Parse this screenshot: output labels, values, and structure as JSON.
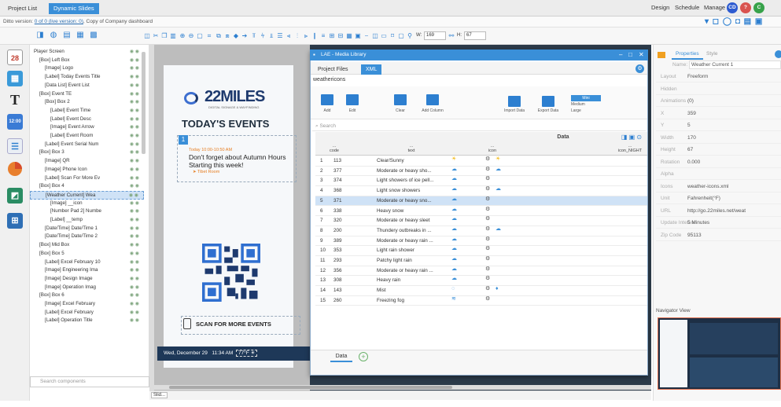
{
  "topbar": {
    "tab_project_list": "Project List",
    "tab_dynamic_slides": "Dynamic Slides",
    "design": "Design",
    "schedule": "Schedule",
    "manage": "Manage",
    "avatars": [
      "CD",
      "",
      "C"
    ]
  },
  "subbar": {
    "version_prefix": "Ditto version: ",
    "version_link": "0 of 0 (live version: 0)",
    "version_suffix": ", Copy of Company dashboard"
  },
  "toolbar": {
    "width_label": "W:",
    "width_value": "169",
    "height_label": "H:",
    "height_value": "67"
  },
  "leftbar": {
    "calendar_day": "28",
    "text_tool": "T"
  },
  "tree": {
    "items": [
      {
        "label": "Player Screen",
        "indent": 0
      },
      {
        "label": "[Box] Left Box",
        "indent": 1
      },
      {
        "label": "[Image] Logo",
        "indent": 2
      },
      {
        "label": "[Label] Today Events Title",
        "indent": 2
      },
      {
        "label": "[Data List] Event List",
        "indent": 2
      },
      {
        "label": "[Box] Event TE",
        "indent": 1
      },
      {
        "label": "[Box] Box 2",
        "indent": 2
      },
      {
        "label": "[Label] Event Time",
        "indent": 3
      },
      {
        "label": "[Label] Event Desc",
        "indent": 3
      },
      {
        "label": "[Image] Event Arrow",
        "indent": 3
      },
      {
        "label": "[Label] Event Room",
        "indent": 3
      },
      {
        "label": "[Label] Event Serial Num",
        "indent": 2
      },
      {
        "label": "[Box] Box 3",
        "indent": 1
      },
      {
        "label": "[Image] QR",
        "indent": 2
      },
      {
        "label": "[Image] Phone Icon",
        "indent": 2
      },
      {
        "label": "[Label] Scan For More Ev",
        "indent": 2
      },
      {
        "label": "[Box] Box 4",
        "indent": 1
      },
      {
        "label": "[Weather Current] Wea",
        "indent": 2
      },
      {
        "label": "[Image] __icon",
        "indent": 3
      },
      {
        "label": "[Number Pad 2] Numbe",
        "indent": 3
      },
      {
        "label": "[Label] __temp",
        "indent": 3
      },
      {
        "label": "[Date/Time] Date/Time 1",
        "indent": 2
      },
      {
        "label": "[Date/Time] Date/Time 2",
        "indent": 2
      },
      {
        "label": "[Box] Mid Box",
        "indent": 1
      },
      {
        "label": "[Box] Box 5",
        "indent": 1
      },
      {
        "label": "[Label] Excel February 10",
        "indent": 2
      },
      {
        "label": "[Image] Engineering Ima",
        "indent": 2
      },
      {
        "label": "[Image] Design Image",
        "indent": 2
      },
      {
        "label": "[Image] Operation Imag",
        "indent": 2
      },
      {
        "label": "[Box] Box 6",
        "indent": 1
      },
      {
        "label": "[Image] Excel February",
        "indent": 2
      },
      {
        "label": "[Label] Excel February",
        "indent": 2
      },
      {
        "label": "[Label] Operation Title",
        "indent": 2
      }
    ],
    "selected_index": 17,
    "search_placeholder": "Search components"
  },
  "canvas": {
    "logo_text": "22MILES",
    "logo_sub": "DIGITAL SIGNAGE & WAYFINDING",
    "title": "TODAY'S EVENTS",
    "event_num": "1",
    "event_time": "Today 10:00-10:50 AM",
    "event_desc": "Don't forget about Autumn Hours Starting this week!",
    "event_room": "Tibet Room",
    "scan_text": "SCAN FOR MORE EVENTS",
    "bottom_date": "Wed, December 29",
    "bottom_time": "11:34 AM",
    "bottom_temp": "77°F",
    "bottom_tab": "Slid..."
  },
  "modal": {
    "title": "LAE - Media Library",
    "tab_project": "Project Files",
    "tab_xml": "XML",
    "name": "weathericons",
    "buttons": [
      "Add",
      "Edit",
      "Clear",
      "Add Column",
      "Import Data",
      "Export Data"
    ],
    "size_options": [
      "Mini",
      "Medium",
      "Large"
    ],
    "search_placeholder": "Search",
    "data_header": "Data",
    "col_index": "...",
    "col_code": "code",
    "col_text": "text",
    "col_icon": "icon",
    "col_night": "icon_NIGHT",
    "rows": [
      {
        "n": "1",
        "code": "113",
        "text": "Clear/Sunny",
        "icon": "sun",
        "night": "sun"
      },
      {
        "n": "2",
        "code": "377",
        "text": "Moderate or heavy sho...",
        "icon": "cloud",
        "night": "cloud"
      },
      {
        "n": "3",
        "code": "374",
        "text": "Light showers of ice pell...",
        "icon": "cloud",
        "night": ""
      },
      {
        "n": "4",
        "code": "368",
        "text": "Light snow showers",
        "icon": "cloud",
        "night": "cloud"
      },
      {
        "n": "5",
        "code": "371",
        "text": "Moderate or heavy sno...",
        "icon": "cloud",
        "night": ""
      },
      {
        "n": "6",
        "code": "338",
        "text": "Heavy snow",
        "icon": "cloud",
        "night": ""
      },
      {
        "n": "7",
        "code": "320",
        "text": "Moderate or heavy sleet",
        "icon": "cloud",
        "night": ""
      },
      {
        "n": "8",
        "code": "200",
        "text": "Thundery outbreaks in ...",
        "icon": "cloud",
        "night": "cloud"
      },
      {
        "n": "9",
        "code": "389",
        "text": "Moderate or heavy rain ...",
        "icon": "cloud",
        "night": ""
      },
      {
        "n": "10",
        "code": "353",
        "text": "Light rain shower",
        "icon": "cloud",
        "night": ""
      },
      {
        "n": "11",
        "code": "293",
        "text": "Patchy light rain",
        "icon": "cloud",
        "night": ""
      },
      {
        "n": "12",
        "code": "356",
        "text": "Moderate or heavy rain ...",
        "icon": "cloud",
        "night": ""
      },
      {
        "n": "13",
        "code": "308",
        "text": "Heavy rain",
        "icon": "cloud",
        "night": ""
      },
      {
        "n": "14",
        "code": "143",
        "text": "Mist",
        "icon": "mist",
        "night": "drop"
      },
      {
        "n": "15",
        "code": "260",
        "text": "Freezing fog",
        "icon": "fog",
        "night": ""
      }
    ],
    "selected_row": 4,
    "footer_tab": "Data",
    "footer_add": "+"
  },
  "props": {
    "tab_properties": "Properties",
    "tab_style": "Style",
    "name_label": "Name:",
    "name_value": "Weather Current 1",
    "rows": [
      {
        "label": "Layout",
        "value": "Freeform"
      },
      {
        "label": "Hidden",
        "value": ""
      },
      {
        "label": "Animations",
        "value": "(0)"
      },
      {
        "label": "X",
        "value": "359"
      },
      {
        "label": "Y",
        "value": "5"
      },
      {
        "label": "Width",
        "value": "170"
      },
      {
        "label": "Height",
        "value": "67"
      },
      {
        "label": "Rotation",
        "value": "0.000"
      },
      {
        "label": "Alpha",
        "value": ""
      },
      {
        "label": "Icons",
        "value": "weather-icons.xml"
      },
      {
        "label": "Unit",
        "value": "Fahrenheit(°F)"
      },
      {
        "label": "URL",
        "value": "http://go.22miles.net/weat"
      },
      {
        "label": "Update Interval",
        "value": "5 Minutes"
      },
      {
        "label": "Zip Code",
        "value": "95113"
      }
    ],
    "navigator": "Navigator View"
  },
  "colors": {
    "accent": "#3a8fd8",
    "dark_bg": "#2c3b4a"
  }
}
